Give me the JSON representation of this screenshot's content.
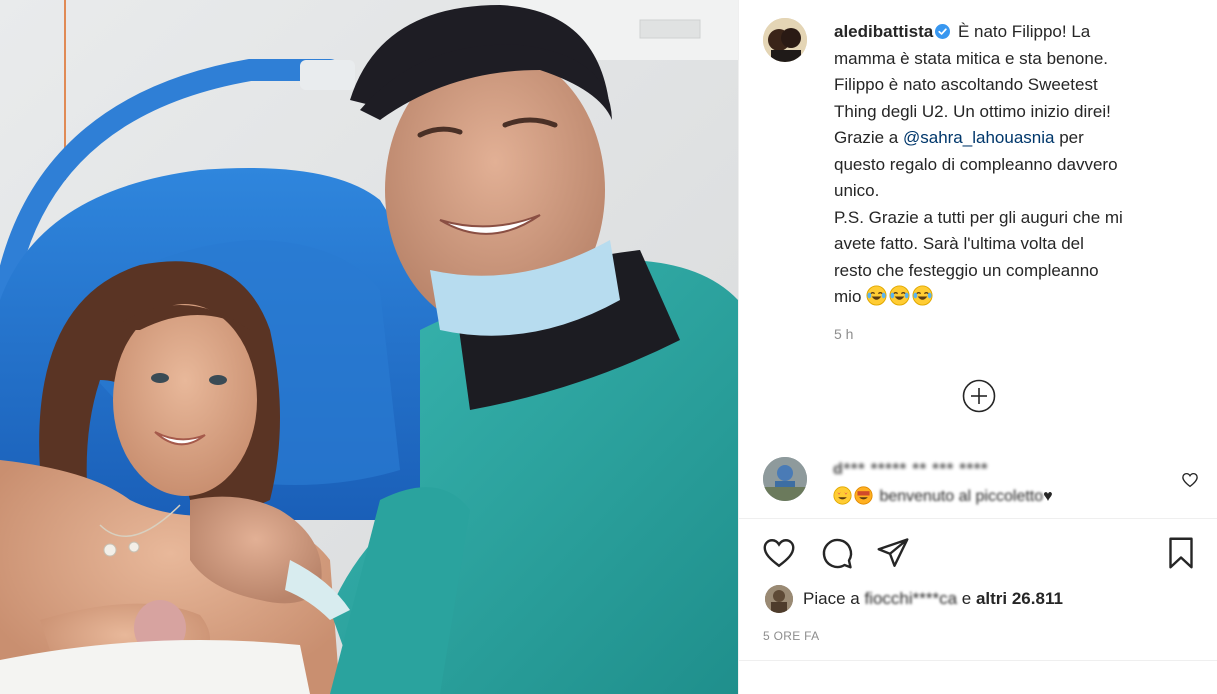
{
  "post": {
    "username": "aledibattista",
    "caption_lines": [
      "È nato Filippo! La",
      "mamma è stata mitica e sta benone.",
      "Filippo è nato ascoltando Sweetest",
      "Thing degli U2. Un ottimo inizio direi!",
      "Grazie a ",
      " per",
      "questo regalo di compleanno davvero",
      "unico.",
      "P.S. Grazie a tutti per gli auguri che mi",
      "avete fatto. Sarà l'ultima volta del",
      "resto che festeggio un compleanno",
      "mio"
    ],
    "mention": "@sahra_lahouasnia",
    "time_ago": "5 h",
    "emojis": [
      "tears-of-joy",
      "tears-of-joy",
      "tears-of-joy"
    ]
  },
  "comment": {
    "username": "d*** ***** ** *** ****",
    "text_visible": "benvenuto al piccoletto",
    "heart": "♥"
  },
  "likes": {
    "prefix": "Piace a ",
    "user": "fiocchi****ca",
    "connector": " e ",
    "count": "altri 26.811"
  },
  "date": "5 ORE FA",
  "colors": {
    "verified": "#3897f0",
    "mention": "#00376b",
    "muted": "#8e8e8e",
    "text": "#262626"
  }
}
